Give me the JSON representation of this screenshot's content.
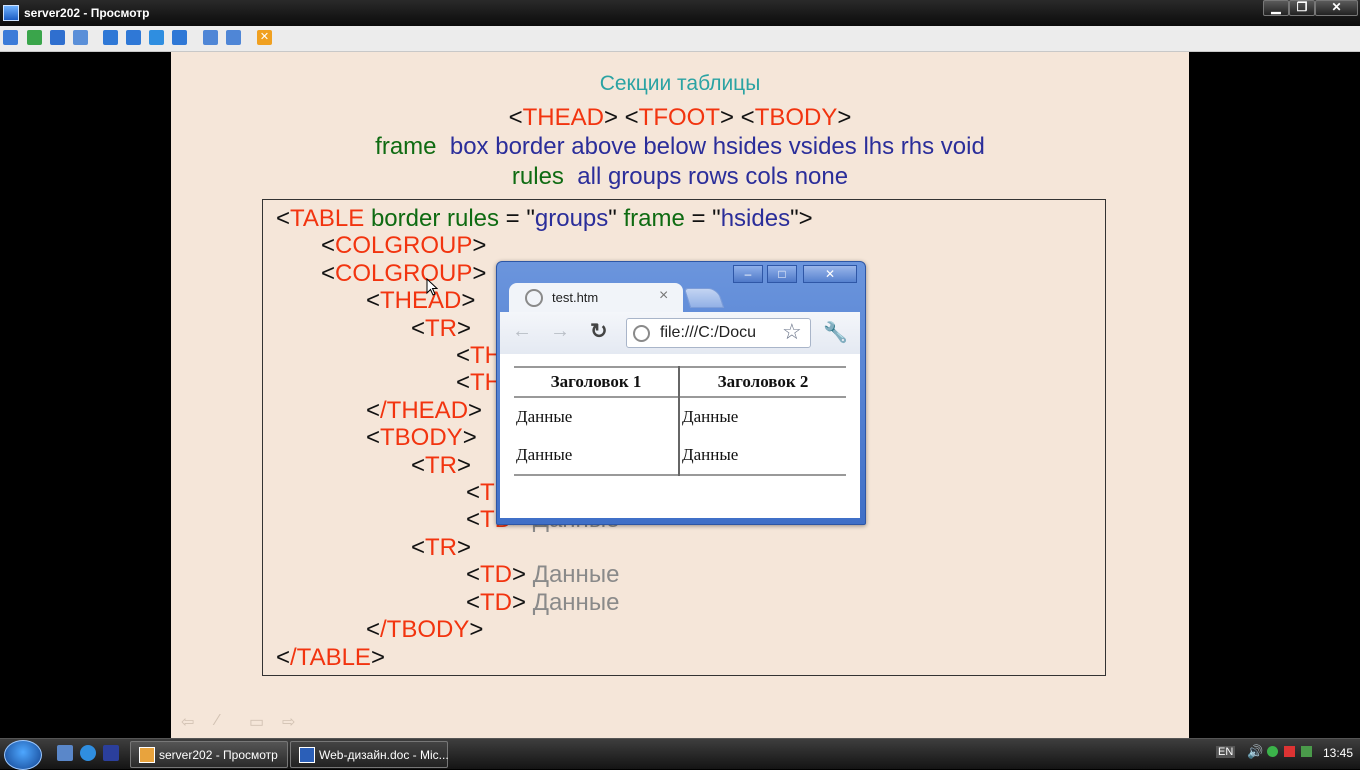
{
  "window": {
    "title": "server202 - Просмотр"
  },
  "toolbar": {
    "icons": [
      "monitor-icon",
      "refresh-icon",
      "phone-icon",
      "chat-icon",
      "window-icon",
      "fit-icon",
      "fullscreen-icon",
      "zoom-icon",
      "copy-icon",
      "tools-icon",
      "close-icon"
    ]
  },
  "slide": {
    "heading": "Секции таблицы",
    "line1": {
      "thead": "THEAD",
      "tfoot": "TFOOT",
      "tbody": "TBODY"
    },
    "line2": {
      "frame": "frame",
      "values": "box border above below hsides vsides lhs rhs void"
    },
    "line3": {
      "rules": "rules",
      "values": "all groups rows cols none"
    },
    "code": {
      "table_tag": "TABLE",
      "border_rules": "border rules",
      "groups_val": "groups",
      "frame": "frame",
      "hsides_val": "hsides",
      "colgroup": "COLGROUP",
      "thead": "THEAD",
      "close_thead": "/THEAD",
      "tbody": "TBODY",
      "close_tbody": "/TBODY",
      "close_table": "/TABLE",
      "tr": "TR",
      "th_partial": "TH",
      "td": "TD",
      "data": "Данные"
    }
  },
  "browser": {
    "tab_title": "test.htm",
    "tab_close": "×",
    "address": "file:///C:/Docu",
    "table": {
      "headers": [
        "Заголовок 1",
        "Заголовок 2"
      ],
      "rows": [
        [
          "Данные",
          "Данные"
        ],
        [
          "Данные",
          "Данные"
        ]
      ]
    }
  },
  "taskbar": {
    "tasks": [
      "server202 - Просмотр",
      "Web-дизайн.doc - Mic..."
    ],
    "lang": "EN",
    "clock": "13:45"
  }
}
